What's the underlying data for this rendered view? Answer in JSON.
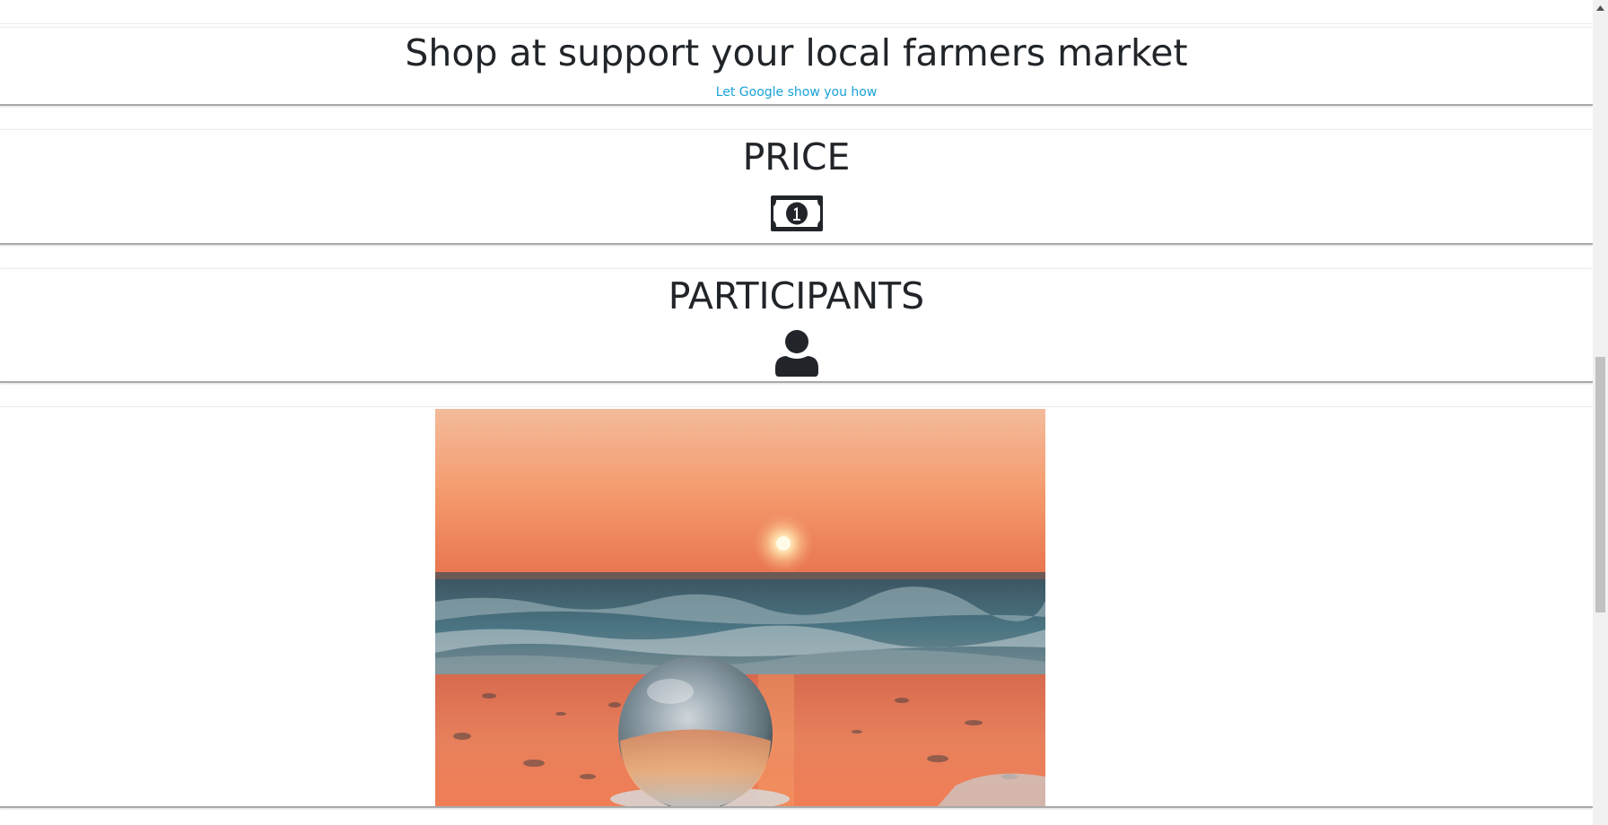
{
  "activity": {
    "title": "Shop at support your local farmers market",
    "link_label": "Let Google show you how"
  },
  "price": {
    "title": "PRICE",
    "icon": "money-bill-icon"
  },
  "participants": {
    "title": "PARTICIPANTS",
    "icon": "user-icon"
  },
  "photo": {
    "subject": "crystal ball on beach at sunset"
  },
  "colors": {
    "link": "#17a2d8",
    "text": "#212529",
    "card_border": "#a9a9a9"
  }
}
